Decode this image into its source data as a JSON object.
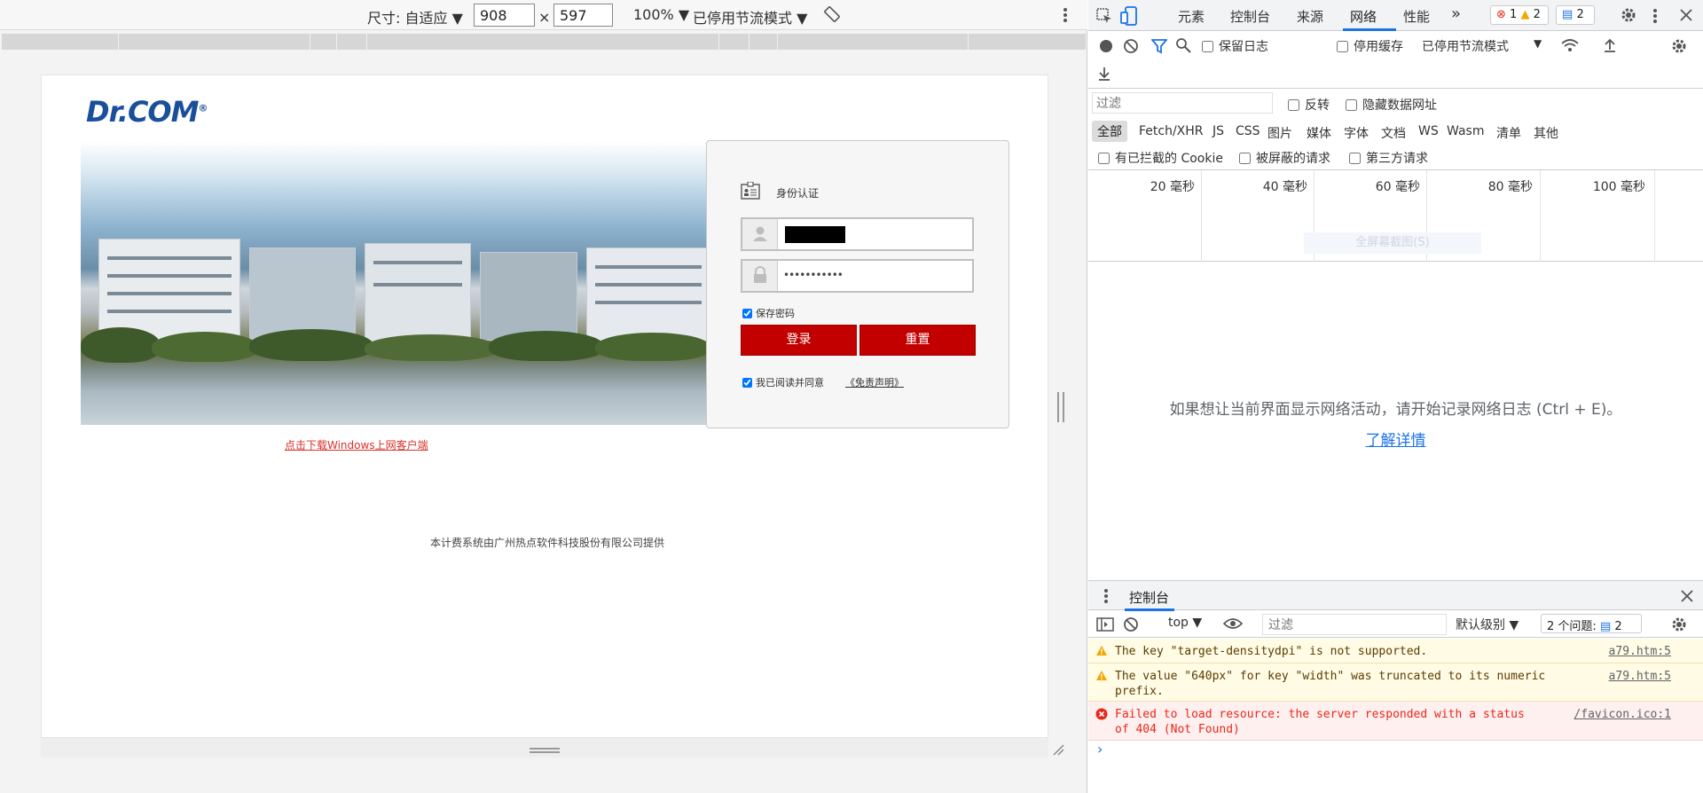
{
  "device_toolbar": {
    "size_label": "尺寸: 自适应 ▼",
    "width": "908",
    "times": "×",
    "height": "597",
    "zoom": "100% ▼",
    "throttle": "已停用节流模式 ▼"
  },
  "page": {
    "logo": "Dr.COM",
    "logo_mark": "®",
    "auth_title": "身份认证",
    "password_mask": "•••••••••••",
    "save_password": "保存密码",
    "login_button": "登录",
    "reset_button": "重置",
    "agree_text": "我已阅读并同意",
    "disclaimer": "《免责声明》",
    "download_link": "点击下载Windows上网客户端",
    "footer": "本计费系统由广州热点软件科技股份有限公司提供"
  },
  "devtools": {
    "tabs": [
      "元素",
      "控制台",
      "来源",
      "网络",
      "性能"
    ],
    "active_tab": "网络",
    "more_tabs": "»",
    "errors": "1",
    "warnings": "2",
    "infos": "2",
    "network_toolbar": {
      "preserve_log": "保留日志",
      "disable_cache": "停用缓存",
      "throttle": "已停用节流模式",
      "throttle_arrow": "▼"
    },
    "filter_placeholder": "过滤",
    "invert": "反转",
    "hide_data_urls": "隐藏数据网址",
    "types": [
      "全部",
      "Fetch/XHR",
      "JS",
      "CSS",
      "图片",
      "媒体",
      "字体",
      "文档",
      "WS",
      "Wasm",
      "清单",
      "其他"
    ],
    "blocked_cookies": "有已拦截的 Cookie",
    "blocked_requests": "被屏蔽的请求",
    "third_party": "第三方请求",
    "timeline_labels": [
      "20 毫秒",
      "40 毫秒",
      "60 毫秒",
      "80 毫秒",
      "100 毫秒"
    ],
    "screenshot_button": "全屏幕截图(S)",
    "empty_message": "如果想让当前界面显示网络活动，请开始记录网络日志 (Ctrl + E)。",
    "learn_more": "了解详情",
    "drawer_tab": "控制台",
    "context": "top ▼",
    "console_filter_placeholder": "过滤",
    "default_levels": "默认级别 ▼",
    "issues": "2 个问题:",
    "issues_count": "2",
    "messages": [
      {
        "level": "warning",
        "text": "The key \"target-densitydpi\" is not supported.",
        "source": "a79.htm:5"
      },
      {
        "level": "warning",
        "text": "The value \"640px\" for key \"width\" was truncated to its numeric\nprefix.",
        "source": "a79.htm:5"
      },
      {
        "level": "error",
        "text": "Failed to load resource: the server responded with a status\nof 404 (Not Found)",
        "source": "/favicon.ico:1"
      }
    ],
    "prompt": "›"
  },
  "colors": {
    "accent": "#1a73e8",
    "login_red": "#c30000",
    "error_red": "#e8281c",
    "warning_yellow": "#f2a600"
  }
}
